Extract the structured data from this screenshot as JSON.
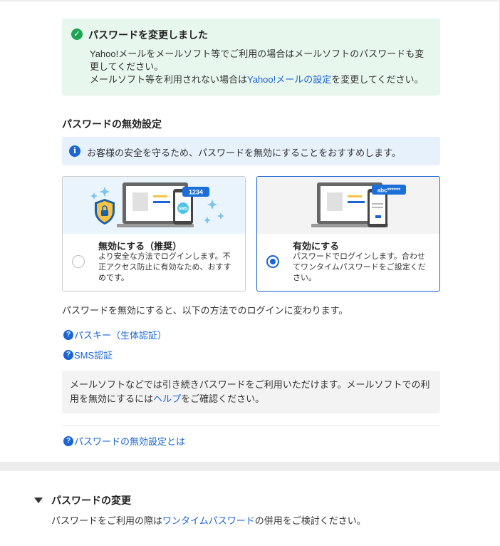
{
  "success": {
    "title": "パスワードを変更しました",
    "line1": "Yahoo!メールをメールソフト等でご利用の場合はメールソフトのパスワードも変更してください。",
    "line2_pre": "メールソフト等を利用されない場合は",
    "line2_link": "Yahoo!メールの設定",
    "line2_post": "を変更してください。",
    "check_glyph": "✓"
  },
  "disable_section": {
    "title": "パスワードの無効設定",
    "info_icon": "i",
    "info_text": "お客様の安全を守るため、パスワードを無効にすることをおすすめします。",
    "options": [
      {
        "title": "無効にする（推奨）",
        "description": "より安全な方法でログインします。不正アクセス防止に有効なため、おすすめです。",
        "selected": false,
        "phone_badge": "1234",
        "sms_badge": "SMS"
      },
      {
        "title": "有効にする",
        "description": "パスワードでログインします。合わせてワンタイムパスワードをご設定ください。",
        "selected": true,
        "password_badge": "abc******"
      }
    ],
    "after_text": "パスワードを無効にすると、以下の方法でのログインに変わります。",
    "methods": [
      {
        "label": "パスキー（生体認証）",
        "icon": "?"
      },
      {
        "label": "SMS認証",
        "icon": "?"
      }
    ],
    "note_pre": "メールソフトなどでは引き続きパスワードをご利用いただけます。メールソフトでの利用を無効にするには",
    "note_link": "ヘルプ",
    "note_post": "をご確認ください。",
    "about_link": {
      "label": "パスワードの無効設定とは",
      "icon": "?"
    }
  },
  "change_section": {
    "title": "パスワードの変更",
    "desc_pre": "パスワードをご利用の際は",
    "desc_link": "ワンタイムパスワード",
    "desc_post": "の併用をご検討ください。"
  },
  "colors": {
    "accent": "#1a64d4",
    "success": "#1fa453",
    "success_bg": "#e8f7ee",
    "info_bg": "#e6f1fc"
  }
}
